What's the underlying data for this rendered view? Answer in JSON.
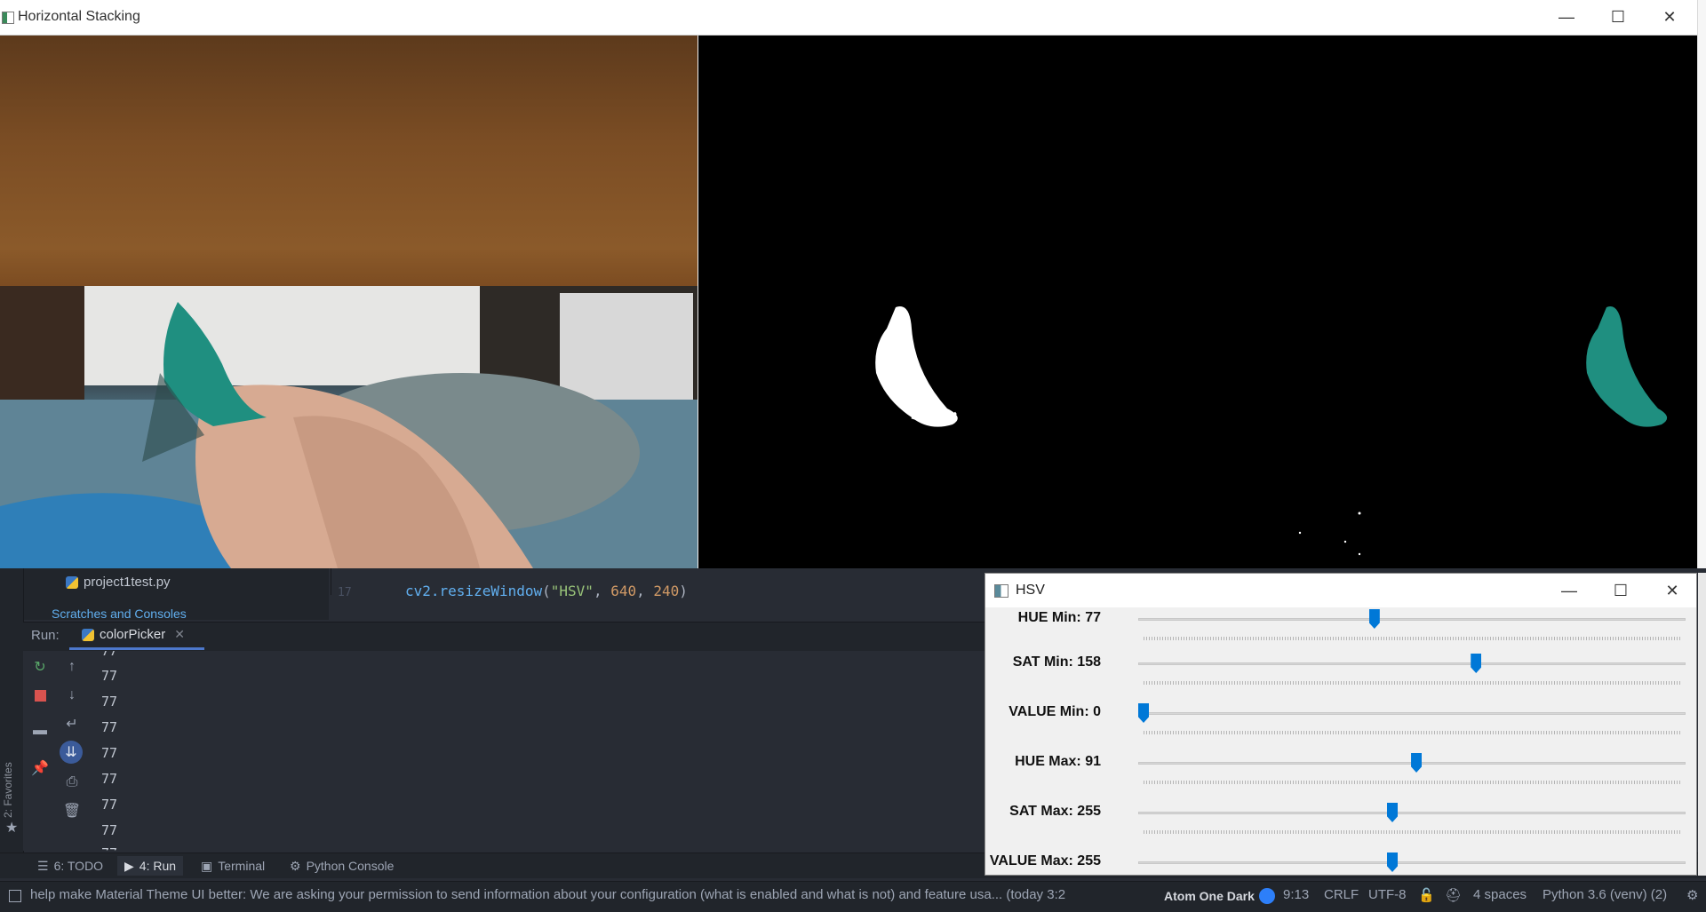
{
  "ide": {
    "project": {
      "file": "project1test.py",
      "scratches": "Scratches and Consoles"
    },
    "editor": {
      "line_number": "17",
      "code": {
        "fn": "cv2.resizeWindow",
        "open": "(",
        "str": "\"HSV\"",
        "sep1": ", ",
        "num1": "640",
        "sep2": ", ",
        "num2": "240",
        "close": ")"
      }
    },
    "run": {
      "label": "Run:",
      "tab": "colorPicker",
      "output": [
        "77",
        "77",
        "77",
        "77",
        "77",
        "77",
        "77",
        "77",
        "77"
      ]
    },
    "sidebar": {
      "favorites": "2: Favorites"
    },
    "bottom_tabs": [
      {
        "label": "6: TODO",
        "icon": "list-icon"
      },
      {
        "label": "4: Run",
        "icon": "play-icon"
      },
      {
        "label": "Terminal",
        "icon": "terminal-icon"
      },
      {
        "label": "Python Console",
        "icon": "python-icon"
      }
    ],
    "status": {
      "message": "help make Material Theme UI better: We are asking your permission to send information about your configuration (what is enabled and what is not) and feature usa... (today 3:2",
      "theme": "Atom One Dark",
      "position": "9:13",
      "line_sep": "CRLF",
      "encoding": "UTF-8",
      "indent": "4 spaces",
      "interpreter": "Python 3.6 (venv) (2)"
    }
  },
  "main_window": {
    "title": "Horizontal Stacking",
    "controls": {
      "minimize": "—",
      "maximize": "☐",
      "close": "✕"
    }
  },
  "hsv_window": {
    "title": "HSV",
    "sliders": [
      {
        "label": "HUE Min: 77",
        "value": 77,
        "max": 179
      },
      {
        "label": "SAT Min: 158",
        "value": 158,
        "max": 255
      },
      {
        "label": "VALUE Min: 0",
        "value": 0,
        "max": 255
      },
      {
        "label": "HUE Max: 91",
        "value": 91,
        "max": 179
      },
      {
        "label": "SAT Max: 255",
        "value": 255,
        "max": 255
      },
      {
        "label": "VALUE Max: 255",
        "value": 255,
        "max": 255
      }
    ]
  },
  "colors": {
    "accent": "#4d78cc",
    "slider_thumb": "#0078d7",
    "ide_bg": "#282c34",
    "teal_object": "#1f8f80"
  }
}
